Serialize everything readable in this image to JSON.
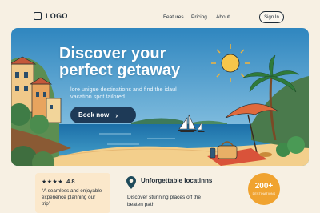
{
  "header": {
    "logo_text": "LOGO",
    "nav": [
      {
        "label": "Features"
      },
      {
        "label": "Pricing"
      },
      {
        "label": "About"
      }
    ],
    "signin_label": "Sign In"
  },
  "hero": {
    "title": "Discover your perfect getaway",
    "subtitle": "lore unigue destinations and find the idaul vacation spot tailored",
    "button_label": "Book now",
    "button_icon": "arrow-right-icon"
  },
  "review": {
    "stars_text": "★★★★",
    "rating": "4.8",
    "quote": "“A seamless and enjoyable experience planning our trip”"
  },
  "feature": {
    "icon": "map-pin-icon",
    "title": "Unforgettable locatinns",
    "description": "Discover stunning places off the beaten path"
  },
  "badge": {
    "number": "200+",
    "label": "DESTINATIONS"
  },
  "colors": {
    "background": "#f7f0e3",
    "primary_button": "#1e3a57",
    "badge": "#f0a330",
    "review_card": "#fbe8cb"
  }
}
